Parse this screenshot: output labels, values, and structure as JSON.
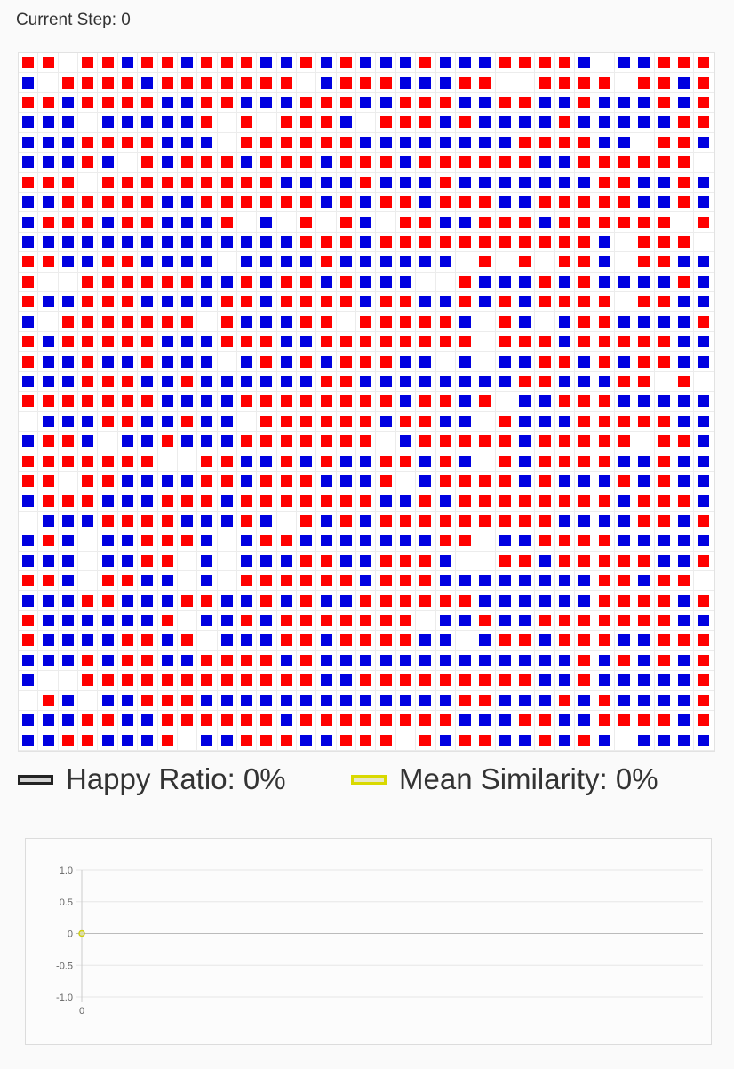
{
  "header": {
    "current_step": "Current Step: 0"
  },
  "colors": {
    "red": "#ff0000",
    "blue": "#0000e0",
    "happy_swatch_border": "#222222",
    "happy_swatch_fill": "#d3d3d3",
    "similarity_swatch_border": "#d9d900",
    "similarity_swatch_fill": "#e8e8c8"
  },
  "grid": {
    "legend_code": "R = red agent, B = blue agent, . = empty cell",
    "rows": [
      "RR.RRBRRBRRRBBRBRBBBRBBBRRRRB.BBRRR",
      "B.RRRRBRRRRRRR.BRRRBBBRR..RRRR.RRBR",
      "RRBRRRRBBRRBBBRRRBBRRRBBRRBBRBBBRBR",
      "BBB.BBBBBR.R.RRRB.RRRBRBBBBRBBBBBRR",
      "BBBRRRRBBB.RRRRRRBBBBBBBBRRRRBB.RRB",
      "BBBRB.RBRRRBRRRBRRRBRRRRRRBBRRRRRR.B",
      "RRR.RRRRRRRRRBBBBRBBBRBBBBBBBRRBBRB",
      "BBRRRRRBBRRRRRRBRBRRBRRRBBRRRRRBBRB",
      "BRRRBRRBBBR.B.R.RB.RRBBRRRBRRRRRR.R",
      "BBBBBBBBBBBBBBRRRBRRRRRRRRRRRB.RRR.",
      "RRBBRRBBBB.BBBBRBBBBBB.R.R.RRB.RRBB",
      "R..RRRRRRBBRBRRBRBBB..RBBBRBRBBBBRB",
      "RBBRRRBBBBRRBRRRRBRRBBRBRBRRRR.RRBB",
      "B.RRRRRRR.RBBBRR.RRRRRB.RB.BRRBBBBR",
      "RBRRRRRBBBRRRBBRRRRRRRR.RRRBRRRRRBBR",
      "RBBRBBRBBB.BRBRBRRRBB.B.BBRRBRBRRBB",
      "BBBRRRBBRBBBBBBRRBBBBBBBBRRBBBRR.R.",
      "RRRRRRRBBBBRRRRRRRRBRRBR.BBRRRBBBBB",
      ".BBBRRBBRBB.RRRRRRBRRBB.RBBBRRRRRBB",
      "BRRB.BBRBBBRRRRRRR.BRRRRRBRRRRR.RRB",
      "RRRRRRR..RRBBRBRBBRRBRB.RBRRRRBBRBB",
      "RR.RRBBBBRRBRRRBBBR.BRRRRBRBBBRBRBB",
      "BRRRBBBRRRBRRRRRRRBBRBRRRRRRRRBRRRB",
      ".BBBRRRRBBBRB.RBRBRRRRRRRRRBBBBRRBRB",
      "BRB.BBRRRB.BRRBBBBBBBRR.BBRRRRBBBBB",
      "BBB.BBRR.B.BBBRRBBRRRB..RRBRRRRRBBRR",
      "RRB.RRBB.B.RRRRRRBRRRBBBBBBBBRRBRR.",
      "BBBRRBBBRRBBRBRBBRRRRRRBBBBBBRRRRBRR",
      "RBBBBBBR.BBRBRRRRRRR.BBRBBRRRRRRRBB",
      "RBBBBRRBR.BBBRRBRRRRBB.BRRBRRRBBRRR",
      "BBBRBRRBBRRRRBRBBBBBBBBBBBBBRBRBRBR",
      "B..RRRRRRRRRRRRBBRRRRRRRRRBBRBBBBBR",
      ".RB.BBRRRBBBBBBBBBBBBBRRBBBRBRBBBBR",
      "BBBRRBBRRRRRRBRRRRRRRRBBBRRBBRRRRBR",
      "BBRRBBBR.BBRRRBBRRR.RBRRBBRBRB.BBBB"
    ]
  },
  "legend": {
    "happy_ratio": "Happy Ratio: 0%",
    "mean_similarity": "Mean Similarity: 0%"
  },
  "chart_data": {
    "type": "line",
    "x": [
      0
    ],
    "series": [
      {
        "values": [
          0
        ],
        "color": "#222222"
      },
      {
        "values": [
          0
        ],
        "color": "#d9d900"
      }
    ],
    "yticks": [
      "1.0",
      "0.5",
      "0",
      "-0.5",
      "-1.0"
    ],
    "xticks": [
      "0"
    ],
    "ylim": [
      -1,
      1
    ],
    "grid": true
  }
}
